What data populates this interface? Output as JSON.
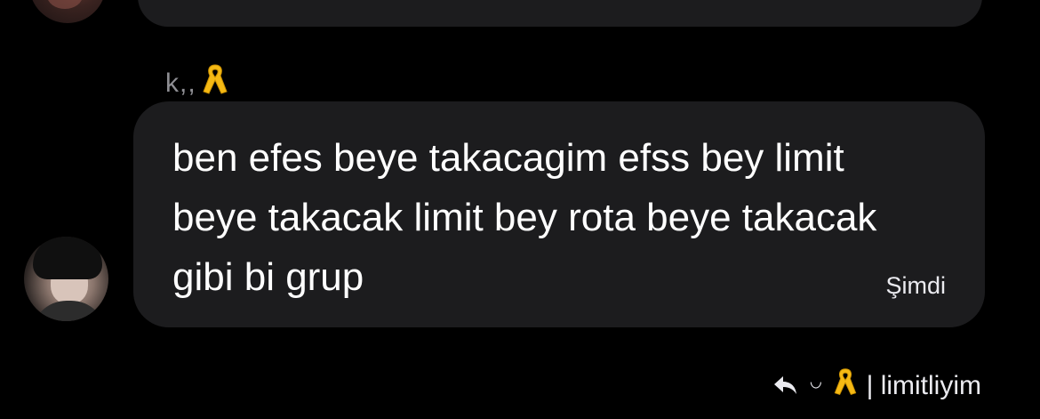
{
  "thread": {
    "sender_name": "k,,",
    "message_text": "ben efes beye takacagim efss bey limit\nbeye takacak limit bey rota beye takacak\ngibi bi grup",
    "timestamp": "Şimdi"
  },
  "footer": {
    "face_text": "꒡",
    "status_text": "| limitliyim"
  },
  "colors": {
    "background": "#000000",
    "bubble": "#1c1c1e",
    "secondary_text": "#8e8e93",
    "ribbon": "#f5b914"
  },
  "icons": [
    "ribbon-icon",
    "reply-icon"
  ]
}
